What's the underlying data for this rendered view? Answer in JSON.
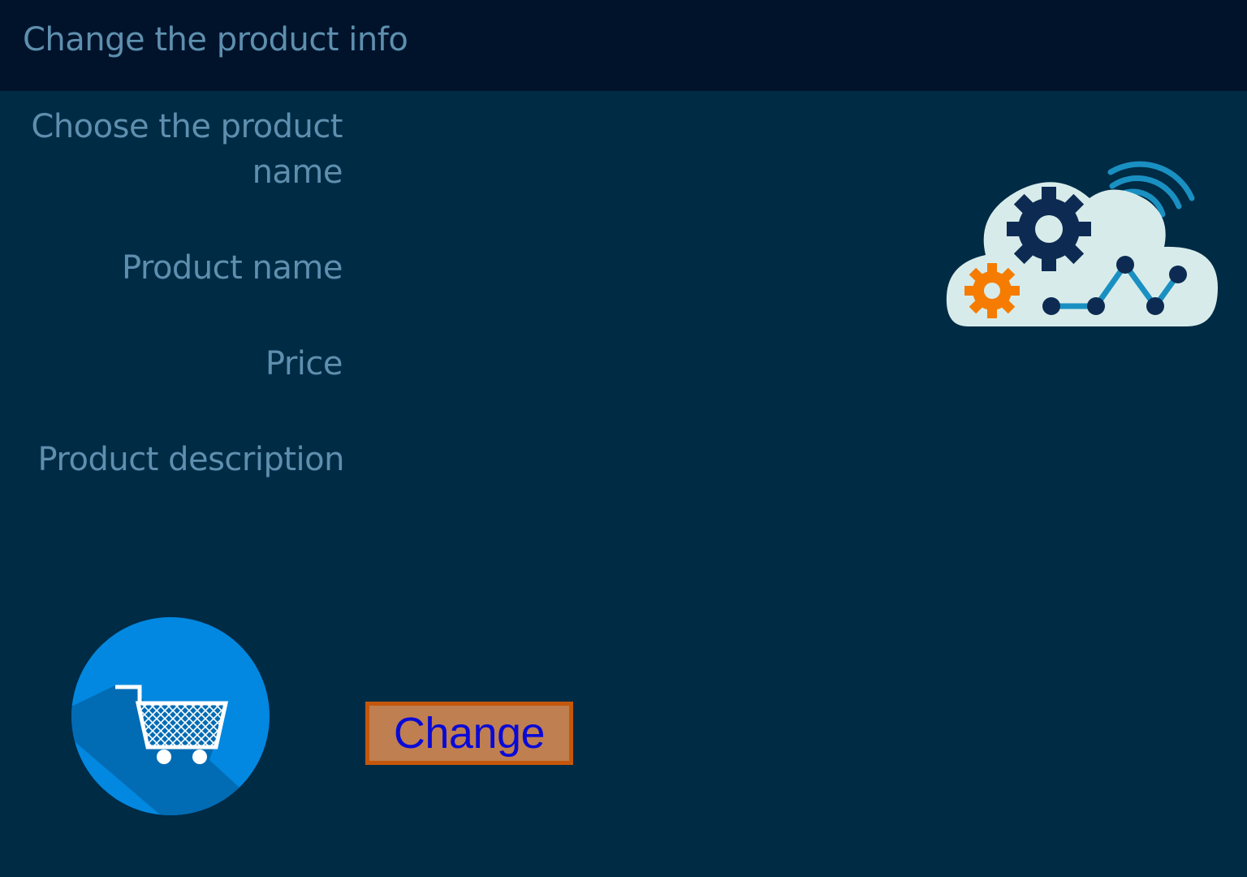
{
  "window": {
    "title": "Change the product info"
  },
  "form": {
    "labels": {
      "choose_product": "Choose the product name",
      "product_name": "Product name",
      "price": "Price",
      "description": "Product description"
    },
    "change_button_label": "Change"
  },
  "graphics": {
    "cloud": "cloud-gears-analytics-icon",
    "cart": "shopping-cart-icon"
  },
  "colors": {
    "header_bg": "#00132b",
    "main_bg": "#002b45",
    "label_text": "#5e8fae",
    "button_bg": "#bf7f50",
    "button_border": "#c4570b",
    "button_text": "#0a0ad6",
    "cart_circle": "#0288e0",
    "gear_dark": "#0d2b52",
    "gear_orange": "#f57c00",
    "cloud_fill": "#d7ecea"
  }
}
